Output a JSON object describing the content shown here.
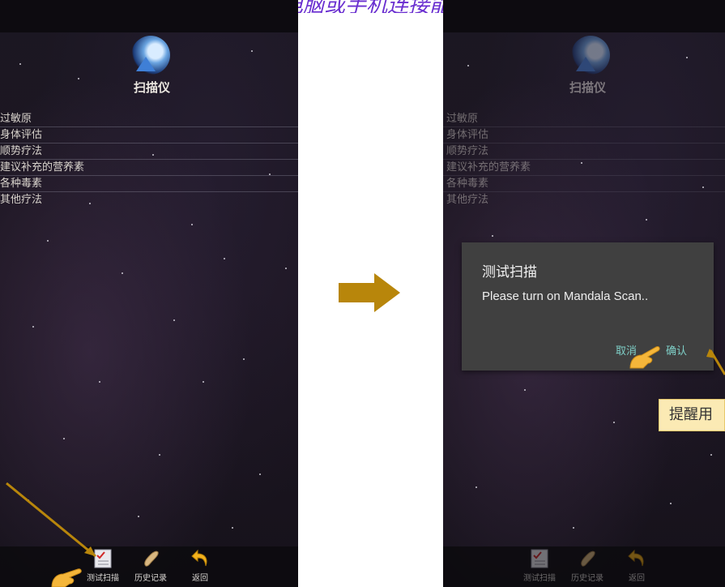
{
  "top_caption": "前，请把荷荷扫描设到平板电脑或手机连接能力。",
  "app": {
    "title": "扫描仪",
    "menu_items": [
      "过敏原",
      "身体评估",
      "顺势疗法",
      "建议补充的营养素",
      "各种毒素",
      "其他疗法"
    ],
    "tabs": [
      {
        "label": "测试扫描",
        "icon": "checklist-icon"
      },
      {
        "label": "历史记录",
        "icon": "scroll-icon"
      },
      {
        "label": "返回",
        "icon": "return-arrow-icon"
      }
    ]
  },
  "dialog": {
    "title": "测试扫描",
    "message": "Please turn on Mandala Scan..",
    "cancel_label": "取消",
    "confirm_label": "确认"
  },
  "hint_box": {
    "text": "提醒用"
  },
  "colors": {
    "caption": "#6a2fd0",
    "arrow": "#b8860b",
    "annotation_line": "#b8860b",
    "dialog_bg": "#404040",
    "dialog_button": "#7fd0c8",
    "hint_bg": "#fbeab4"
  }
}
